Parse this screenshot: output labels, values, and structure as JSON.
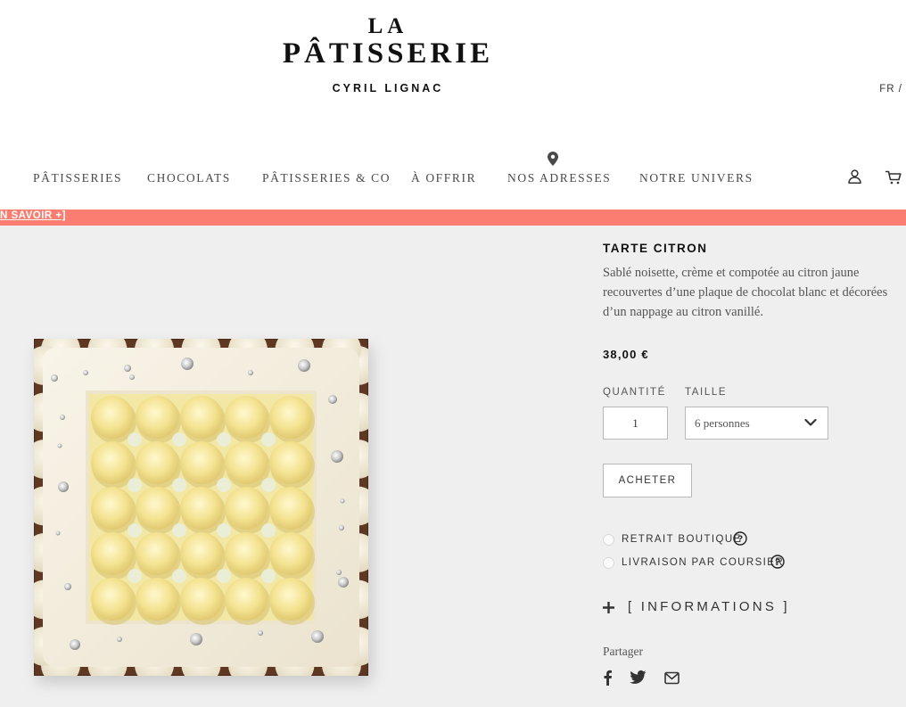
{
  "brand": {
    "line1": "LA",
    "line2": "PÂTISSERIE",
    "line3": "CYRIL LIGNAC"
  },
  "lang": "FR /",
  "nav": {
    "items": [
      {
        "label": "PÂTISSERIES"
      },
      {
        "label": "CHOCOLATS"
      },
      {
        "label": "PÂTISSERIES & CO"
      },
      {
        "label": "À OFFRIR"
      },
      {
        "label": "NOS ADRESSES"
      },
      {
        "label": "NOTRE UNIVERS"
      }
    ],
    "icons": {
      "pin": "map-pin-icon",
      "user": "user-icon",
      "cart": "cart-icon"
    }
  },
  "banner": {
    "link": "N SAVOIR +]",
    "color": "#fb7d72"
  },
  "product": {
    "title": "TARTE CITRON",
    "description": "Sablé noisette, crème et compotée au citron jaune recouvertes d’une plaque de chocolat blanc et décorées d’un nappage au citron vanillé.",
    "price": "38,00 €",
    "quantity_label": "QUANTITÉ",
    "quantity_value": "1",
    "size_label": "TAILLE",
    "size_value": "6 personnes",
    "buy_label": "ACHETER",
    "delivery_options": [
      {
        "label": "RETRAIT BOUTIQUE",
        "selected": false
      },
      {
        "label": "LIVRAISON PAR COURSIER",
        "selected": false
      }
    ],
    "informations_label": "[ INFORMATIONS ]",
    "share_label": "Partager",
    "share_icons": [
      "facebook-icon",
      "twitter-icon",
      "mail-icon"
    ]
  }
}
